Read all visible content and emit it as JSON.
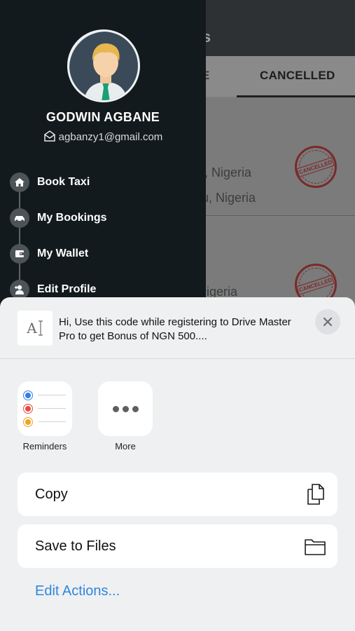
{
  "background": {
    "title_partial": "ngs",
    "tab_partial": "E",
    "tab_cancelled": "CANCELLED",
    "card1_line1": "u, Nigeria",
    "card1_line2": "ru, Nigeria",
    "card2_line1": "Nigeria",
    "stamp_text": "CANCELLED"
  },
  "drawer": {
    "user_name": "GODWIN AGBANE",
    "user_email": "agbanzy1@gmail.com",
    "menu": [
      {
        "label": "Book Taxi",
        "icon": "home-icon"
      },
      {
        "label": "My Bookings",
        "icon": "car-icon"
      },
      {
        "label": "My Wallet",
        "icon": "wallet-icon"
      },
      {
        "label": "Edit Profile",
        "icon": "user-add-icon"
      }
    ]
  },
  "share": {
    "thumb_glyph": "A",
    "text": "Hi, Use this code while registering to Drive Master Pro to get Bonus of NGN 500....",
    "apps": [
      {
        "label": "Reminders"
      },
      {
        "label": "More"
      }
    ],
    "actions": [
      {
        "label": "Copy",
        "icon": "copy-icon"
      },
      {
        "label": "Save to Files",
        "icon": "folder-icon"
      }
    ],
    "edit_actions": "Edit Actions..."
  },
  "colors": {
    "drawer_bg": "#131a1d",
    "sheet_bg": "#eff0f1",
    "link_blue": "#2f86e0",
    "reminder_dots": [
      "#2f7fe6",
      "#e84a3c",
      "#f2a21b"
    ]
  }
}
